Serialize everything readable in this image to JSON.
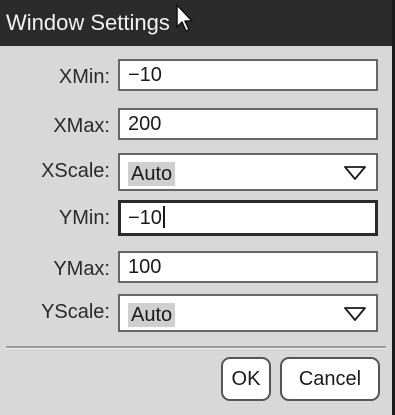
{
  "dialog": {
    "title": "Window Settings",
    "fields": {
      "xmin": {
        "label": "XMin:",
        "value": "−10"
      },
      "xmax": {
        "label": "XMax:",
        "value": "200"
      },
      "xscale": {
        "label": "XScale:",
        "value": "Auto"
      },
      "ymin": {
        "label": "YMin:",
        "value": "−10"
      },
      "ymax": {
        "label": "YMax:",
        "value": "100"
      },
      "yscale": {
        "label": "YScale:",
        "value": "Auto"
      }
    },
    "buttons": {
      "ok": "OK",
      "cancel": "Cancel"
    },
    "icons": {
      "cursor": "mouse-pointer-icon",
      "dropdown": "chevron-down-icon"
    },
    "colors": {
      "title_bar": "#2b2b2b",
      "background": "#d8d8d8",
      "field": "#ffffff",
      "selection_highlight": "#cfcfcf"
    }
  }
}
